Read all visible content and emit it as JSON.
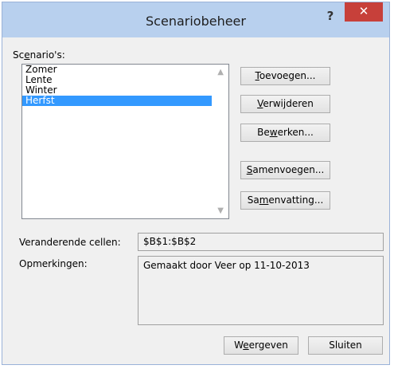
{
  "dialog": {
    "title": "Scenariobeheer",
    "help_label": "?",
    "close_label": "✕"
  },
  "scenarios": {
    "label": "Scenario's:",
    "items": [
      "Zomer",
      "Lente",
      "Winter",
      "Herfst"
    ],
    "selected_index": 3
  },
  "buttons": {
    "add": "Toevoegen...",
    "delete": "Verwijderen",
    "edit": "Bewerken...",
    "merge": "Samenvoegen...",
    "summary": "Samenvatting...",
    "show": "Weergeven",
    "close": "Sluiten"
  },
  "details": {
    "changing_cells_label": "Veranderende cellen:",
    "changing_cells_value": "$B$1:$B$2",
    "comment_label": "Opmerkingen:",
    "comment_value": "Gemaakt door Veer op 11-10-2013"
  },
  "colors": {
    "titlebar": "#b8d0ee",
    "close": "#c7403a",
    "selection": "#3399ff"
  }
}
